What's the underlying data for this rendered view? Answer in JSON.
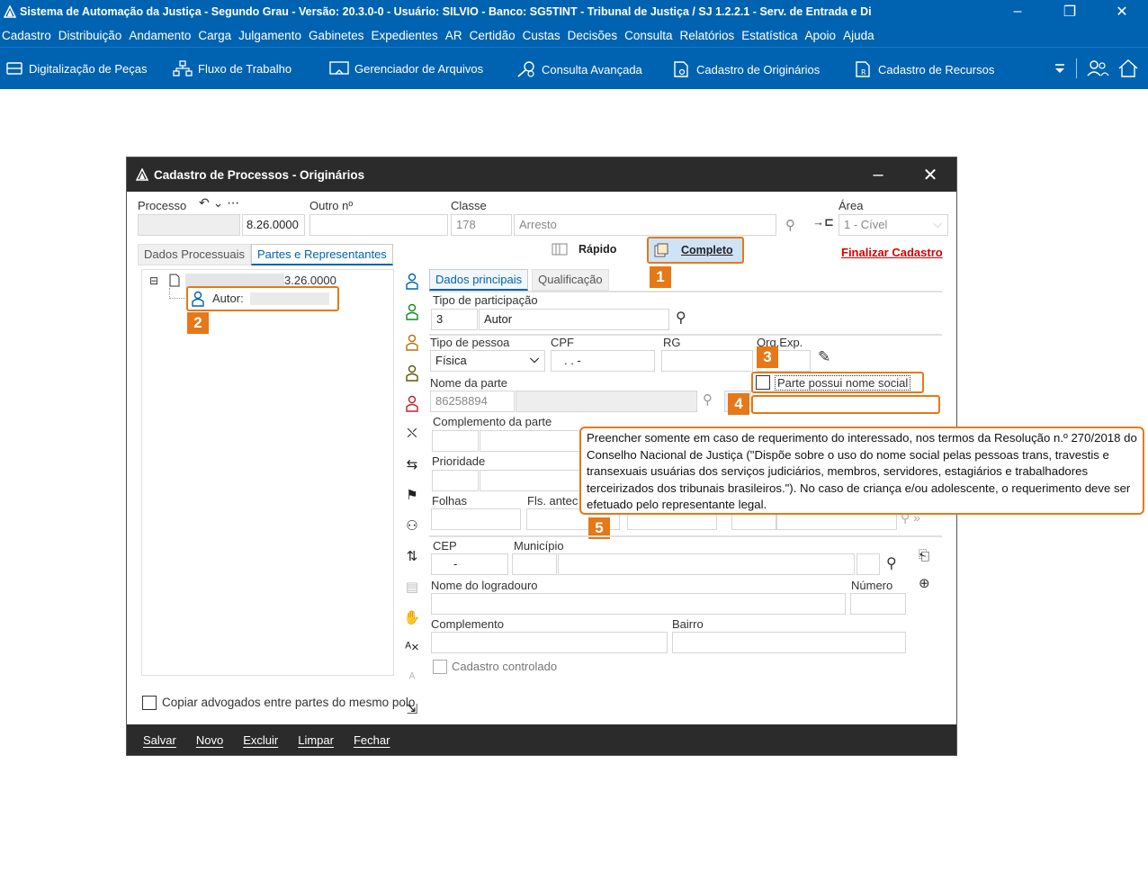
{
  "app": {
    "title": "Sistema de Automação da Justiça - Segundo Grau - Versão: 20.3.0-0 - Usuário: SILVIO - Banco: SG5TINT - Tribunal de Justiça / SJ 1.2.2.1 - Serv. de Entrada e Di",
    "minimize": "–",
    "restore": "❐",
    "close": "✕"
  },
  "menu": [
    "Cadastro",
    "Distribuição",
    "Andamento",
    "Carga",
    "Julgamento",
    "Gabinetes",
    "Expedientes",
    "AR",
    "Certidão",
    "Custas",
    "Decisões",
    "Consulta",
    "Relatórios",
    "Estatística",
    "Apoio",
    "Ajuda"
  ],
  "toolbar": {
    "digitalizacao": "Digitalização de Peças",
    "fluxo": "Fluxo de Trabalho",
    "gerenciador": "Gerenciador de Arquivos",
    "consulta": "Consulta Avançada",
    "originarios": "Cadastro de Originários",
    "recursos": "Cadastro de Recursos"
  },
  "dialog": {
    "title": "Cadastro de Processos - Originários",
    "minimize": "–",
    "close": "✕",
    "processo_label": "Processo",
    "processo_value": "8.26.0000",
    "outro_label": "Outro nº",
    "classe_label": "Classe",
    "classe_code": "178",
    "classe_name": "Arresto",
    "area_label": "Área",
    "area_value": "1 - Cível",
    "tabs": [
      "Dados Processuais",
      "Partes e Representantes"
    ],
    "rapido": "Rápido",
    "completo": "Completo",
    "finalizar": "Finalizar Cadastro",
    "tree_processo": "3.26.0000",
    "tree_autor": "Autor:",
    "subtabs": [
      "Dados principais",
      "Qualificação"
    ],
    "tipo_participacao_label": "Tipo de participação",
    "tipo_participacao_code": "3",
    "tipo_participacao_name": "Autor",
    "tipo_pessoa_label": "Tipo de pessoa",
    "tipo_pessoa_value": "Física",
    "cpf_label": "CPF",
    "cpf_value": ". . -",
    "rg_label": "RG",
    "org_exp_label": "Org.Exp.",
    "nome_social_label": "Parte possui nome social",
    "nome_parte_label": "Nome da parte",
    "nome_parte_code": "86258894",
    "complemento_parte_label": "Complemento da parte",
    "prioridade_label": "Prioridade",
    "folhas_label": "Folhas",
    "fls_ante_label": "Fls. antec",
    "cep_label": "CEP",
    "cep_value": "-",
    "municipio_label": "Município",
    "logradouro_label": "Nome do logradouro",
    "numero_label": "Número",
    "complemento_label": "Complemento",
    "bairro_label": "Bairro",
    "cadastro_controlado_label": "Cadastro controlado",
    "copiar_label": "Copiar advogados entre partes do mesmo polo",
    "buttons": [
      "Salvar",
      "Novo",
      "Excluir",
      "Limpar",
      "Fechar"
    ]
  },
  "callouts": {
    "n1": "1",
    "n2": "2",
    "n3": "3",
    "n4": "4",
    "n5": "5",
    "tooltip": "Preencher somente em caso de requerimento do interessado, nos termos da Resolução n.º 270/2018 do Conselho Nacional de Justiça (\"Dispõe sobre o uso do nome social pelas pessoas trans, travestis e transexuais usuárias dos serviços judiciários, membros, servidores, estagiários e trabalhadores terceirizados dos tribunais brasileiros.\"). No caso de criança e/ou adolescente, o requerimento deve ser efetuado pelo representante legal."
  },
  "colors": {
    "accent": "#0063b1",
    "callout": "#e67817",
    "dark": "#2b2b2b",
    "finalizar": "#d40000"
  }
}
